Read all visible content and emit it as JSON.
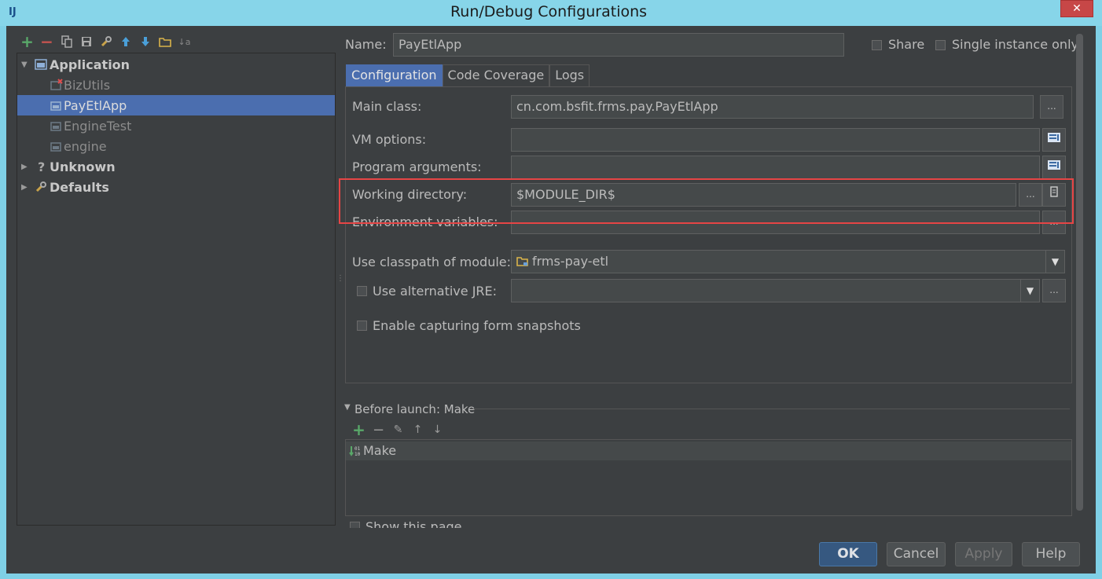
{
  "window": {
    "title": "Run/Debug Configurations",
    "app_icon": "IJ",
    "close": "✕"
  },
  "toolbar": {
    "add": "+",
    "remove": "−",
    "copy": "⎘",
    "save": "💾",
    "edit_defaults": "🔧",
    "move_up": "↑",
    "move_down": "↓",
    "folder": "📁",
    "sort": "↓a"
  },
  "tree": {
    "application": {
      "label": "Application",
      "children": [
        "BizUtils",
        "PayEtlApp",
        "EngineTest",
        "engine"
      ]
    },
    "unknown": {
      "label": "Unknown",
      "icon": "?"
    },
    "defaults": {
      "label": "Defaults"
    }
  },
  "header": {
    "name_label": "Name:",
    "name_value": "PayEtlApp",
    "share_label": "Share",
    "single_instance_label": "Single instance only"
  },
  "tabs": [
    {
      "label": "Configuration",
      "active": true
    },
    {
      "label": "Code Coverage",
      "active": false
    },
    {
      "label": "Logs",
      "active": false
    }
  ],
  "config": {
    "main_class_label": "Main class:",
    "main_class_value": "cn.com.bsfit.frms.pay.PayEtlApp",
    "vm_options_label": "VM options:",
    "vm_options_value": "",
    "program_arguments_label": "Program arguments:",
    "program_arguments_value": "",
    "working_directory_label": "Working directory:",
    "working_directory_value": "$MODULE_DIR$",
    "environment_variables_label": "Environment variables:",
    "environment_variables_value": "",
    "classpath_label": "Use classpath of module:",
    "classpath_value": "frms-pay-etl",
    "alt_jre_label": "Use alternative JRE:",
    "alt_jre_value": "",
    "snapshots_label": "Enable capturing form snapshots",
    "ellipsis": "...",
    "dropdown_arrow": "▼"
  },
  "before_launch": {
    "title": "Before launch: Make",
    "items": [
      "Make"
    ],
    "show_page_label": "Show this page",
    "add": "+",
    "remove": "−",
    "edit": "✎",
    "up": "↑",
    "down": "↓"
  },
  "buttons": {
    "ok": "OK",
    "cancel": "Cancel",
    "apply": "Apply",
    "help": "Help"
  },
  "colors": {
    "accent": "#4b6eaf",
    "highlight": "#e64545",
    "background": "#3c3f41",
    "add_green": "#59a869",
    "remove_red": "#c75450"
  }
}
